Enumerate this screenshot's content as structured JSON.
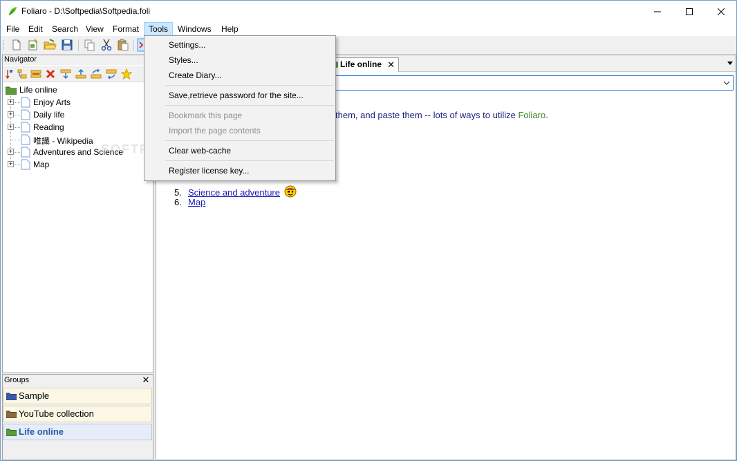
{
  "window": {
    "title": "Foliaro - D:\\Softpedia\\Softpedia.foli"
  },
  "menubar": {
    "items": [
      {
        "label": "File"
      },
      {
        "label": "Edit"
      },
      {
        "label": "Search"
      },
      {
        "label": "View"
      },
      {
        "label": "Format"
      },
      {
        "label": "Tools",
        "active": true
      },
      {
        "label": "Windows"
      },
      {
        "label": "Help"
      }
    ]
  },
  "toolbar": {
    "icons": [
      "new-document-icon",
      "new-from-template-icon",
      "open-folder-icon",
      "save-icon",
      "copy-icon",
      "cut-icon",
      "paste-icon",
      "active-tool-icon"
    ]
  },
  "navigator": {
    "title": "Navigator",
    "tool_icons": [
      "add-child-icon",
      "add-sibling-icon",
      "indent-icon",
      "delete-icon",
      "move-down-icon",
      "move-up-icon",
      "move-right-icon",
      "move-left-icon",
      "favorite-star-icon"
    ],
    "tree": {
      "root": "Life online",
      "children": [
        {
          "label": "Enjoy Arts",
          "expandable": true
        },
        {
          "label": "Daily life",
          "expandable": true
        },
        {
          "label": "Reading",
          "expandable": true
        },
        {
          "label": "唯識 - Wikipedia",
          "expandable": false
        },
        {
          "label": "Adventures and Science",
          "expandable": true
        },
        {
          "label": "Map",
          "expandable": true
        }
      ]
    }
  },
  "groups": {
    "title": "Groups",
    "close_symbol": "✕",
    "items": [
      {
        "label": "Sample",
        "folder_color": "#3a5aa8"
      },
      {
        "label": "YouTube collection",
        "folder_color": "#8a6a40"
      },
      {
        "label": "Life online",
        "folder_color": "#5a9a3a",
        "selected": true
      }
    ]
  },
  "document": {
    "tab_label": "Life online",
    "tab_close": "✕",
    "intro_text": "them, and paste them -- lots of ways to utilize ",
    "intro_brand": "Foliaro",
    "intro_end": ".",
    "list": [
      {
        "num": "5.",
        "label": "Science and adventure"
      },
      {
        "num": "6.",
        "label": "Map"
      }
    ]
  },
  "tools_menu": {
    "items": [
      {
        "label": "Settings...",
        "enabled": true
      },
      {
        "label": "Styles...",
        "enabled": true
      },
      {
        "label": "Create Diary...",
        "enabled": true
      },
      {
        "label": "Save,retrieve password for the site...",
        "enabled": true
      },
      {
        "label": "Bookmark this page",
        "enabled": false
      },
      {
        "label": "Import the page contents",
        "enabled": false
      },
      {
        "label": "Clear web-cache",
        "enabled": true
      },
      {
        "label": "Register license key...",
        "enabled": true
      }
    ]
  },
  "watermark": "SOFTPEDIA",
  "colors": {
    "menu_highlight": "#cce8ff",
    "link": "#1a1ab8",
    "brand_green": "#3a8a1a",
    "selected_group_text": "#2a5aaa"
  }
}
